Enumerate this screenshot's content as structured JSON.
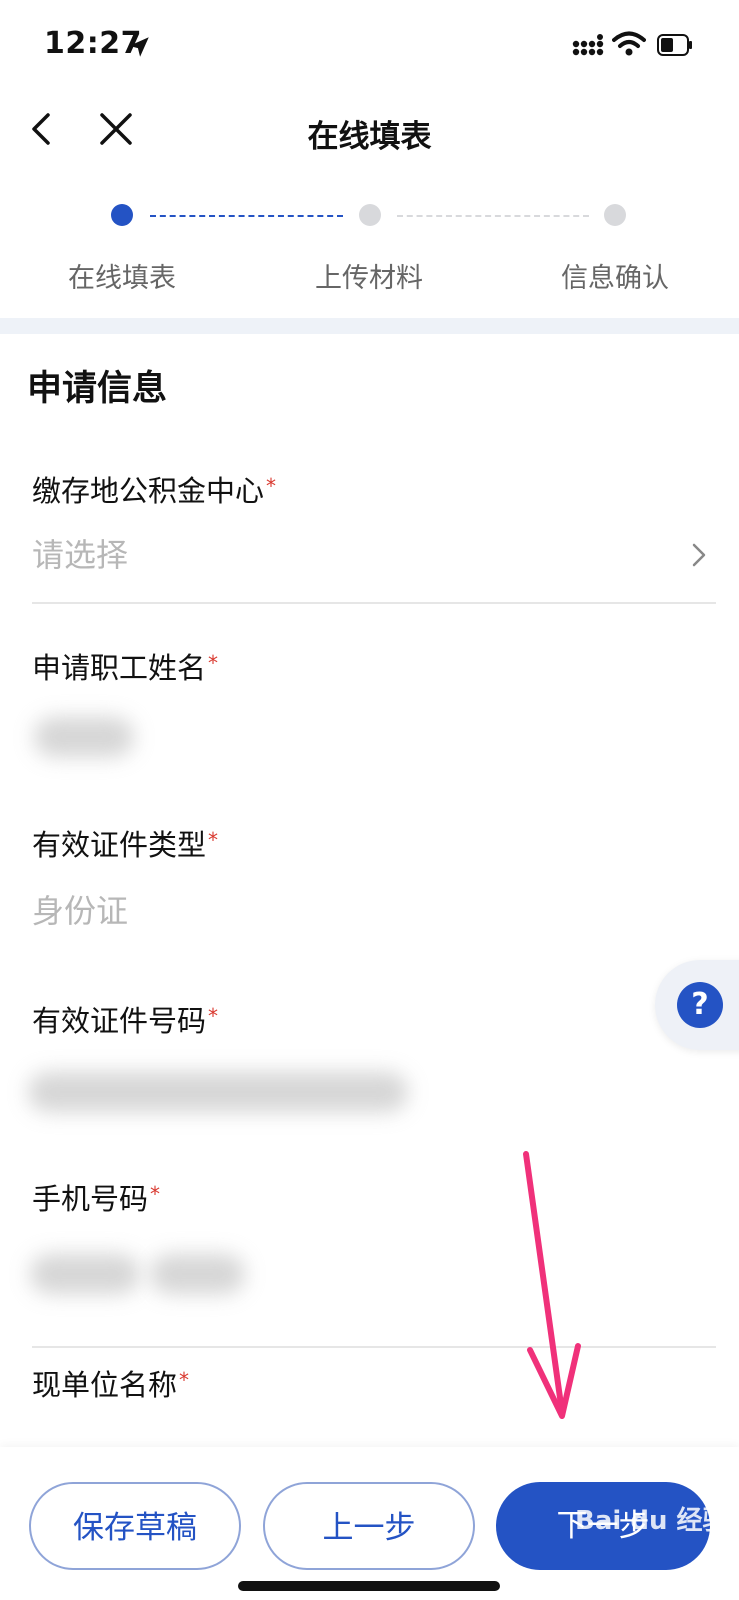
{
  "status": {
    "time": "12:27"
  },
  "nav": {
    "title": "在线填表"
  },
  "steps": [
    {
      "label": "在线填表",
      "state": "active"
    },
    {
      "label": "上传材料",
      "state": "pending"
    },
    {
      "label": "信息确认",
      "state": "pending"
    }
  ],
  "section_title": "申请信息",
  "fields": {
    "center": {
      "label": "缴存地公积金中心",
      "required": "*",
      "placeholder": "请选择"
    },
    "name": {
      "label": "申请职工姓名",
      "required": "*"
    },
    "id_type": {
      "label": "有效证件类型",
      "required": "*",
      "value": "身份证"
    },
    "id_number": {
      "label": "有效证件号码",
      "required": "*"
    },
    "phone": {
      "label": "手机号码",
      "required": "*"
    },
    "employer": {
      "label": "现单位名称",
      "required": "*"
    }
  },
  "help": {
    "icon_text": "?"
  },
  "buttons": {
    "save_draft": "保存草稿",
    "previous": "上一步",
    "next": "下一步"
  },
  "watermark": "Bai du 经验",
  "colors": {
    "accent": "#2453c4",
    "required": "#d9392f",
    "arrow": "#f0317a"
  }
}
